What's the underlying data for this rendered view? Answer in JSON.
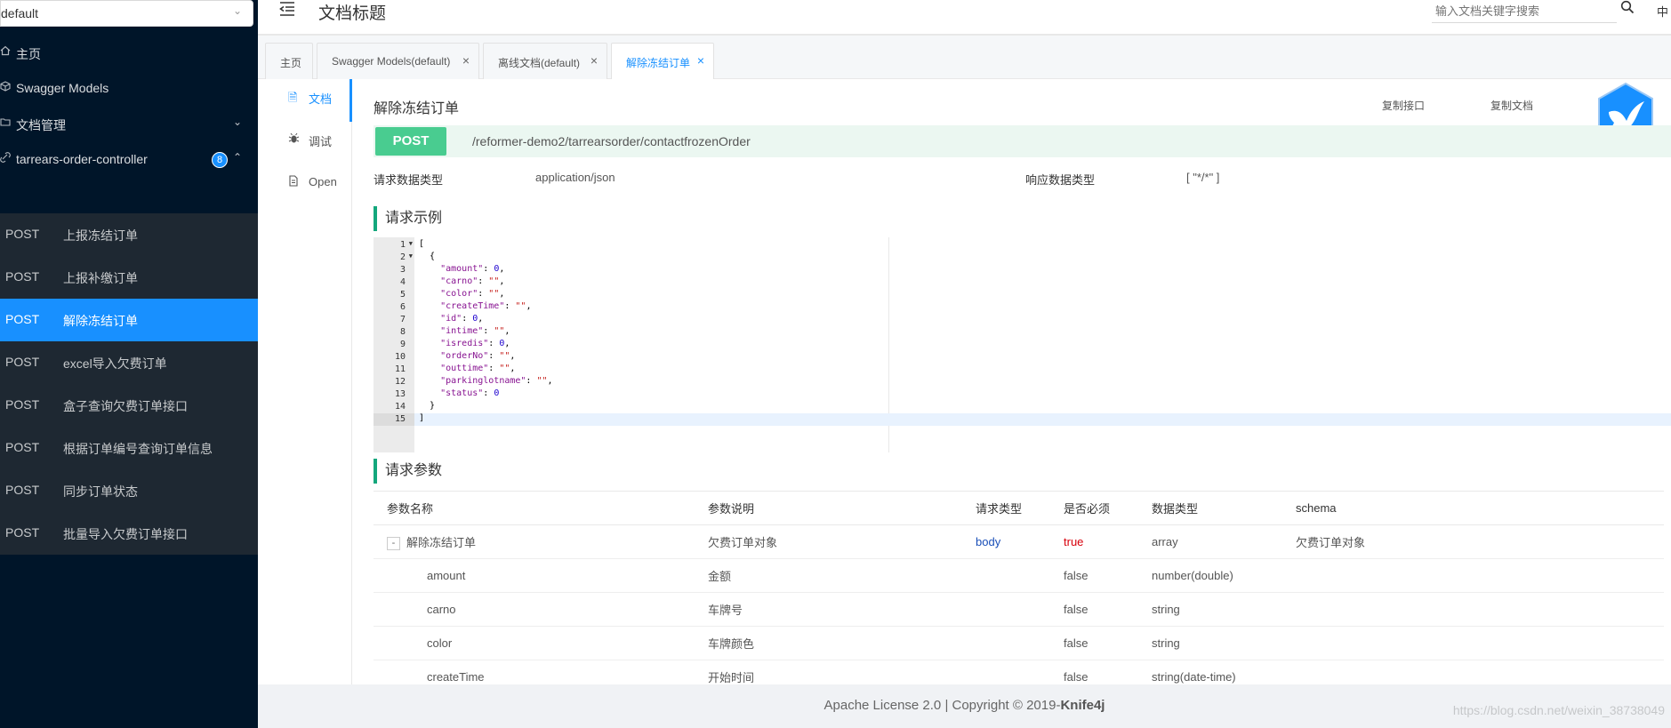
{
  "sidebar": {
    "group_select": "default",
    "items": [
      {
        "label": "主页",
        "icon": "home-icon"
      },
      {
        "label": "Swagger Models",
        "icon": "cube-icon"
      },
      {
        "label": "文档管理",
        "icon": "folder-icon"
      },
      {
        "label": "tarrears-order-controller",
        "icon": "link-icon",
        "badge": "8"
      }
    ],
    "endpoints": [
      {
        "method": "POST",
        "label": "上报冻结订单"
      },
      {
        "method": "POST",
        "label": "上报补缴订单"
      },
      {
        "method": "POST",
        "label": "解除冻结订单"
      },
      {
        "method": "POST",
        "label": "excel导入欠费订单"
      },
      {
        "method": "POST",
        "label": "盒子查询欠费订单接口"
      },
      {
        "method": "POST",
        "label": "根据订单编号查询订单信息"
      },
      {
        "method": "POST",
        "label": "同步订单状态"
      },
      {
        "method": "POST",
        "label": "批量导入欠费订单接口"
      }
    ]
  },
  "header": {
    "title": "文档标题",
    "search_placeholder": "输入文档关键字搜索",
    "lang": "中"
  },
  "tabs": [
    {
      "label": "主页",
      "closable": false
    },
    {
      "label": "Swagger Models(default)",
      "closable": true
    },
    {
      "label": "离线文档(default)",
      "closable": true
    },
    {
      "label": "解除冻结订单",
      "closable": true
    }
  ],
  "modes": [
    {
      "label": "文档",
      "icon": "doc-icon"
    },
    {
      "label": "调试",
      "icon": "bug-icon"
    },
    {
      "label": "Open",
      "icon": "file-icon"
    }
  ],
  "api": {
    "title": "解除冻结订单",
    "copy_api": "复制接口",
    "copy_doc": "复制文档",
    "method": "POST",
    "path": "/reformer-demo2/tarrearsorder/contactfrozenOrder",
    "req_type_label": "请求数据类型",
    "req_type": "application/json",
    "resp_type_label": "响应数据类型",
    "resp_type": "[ \"*/*\" ]"
  },
  "example": {
    "title": "请求示例",
    "lines": [
      "[",
      "  {",
      "    \"amount\": 0,",
      "    \"carno\": \"\",",
      "    \"color\": \"\",",
      "    \"createTime\": \"\",",
      "    \"id\": 0,",
      "    \"intime\": \"\",",
      "    \"isredis\": 0,",
      "    \"orderNo\": \"\",",
      "    \"outtime\": \"\",",
      "    \"parkinglotname\": \"\",",
      "    \"status\": 0",
      "  }",
      "]"
    ]
  },
  "params": {
    "title": "请求参数",
    "headers": [
      "参数名称",
      "参数说明",
      "请求类型",
      "是否必须",
      "数据类型",
      "schema"
    ],
    "rows": [
      {
        "name": "解除冻结订单",
        "desc": "欠费订单对象",
        "in": "body",
        "required": "true",
        "type": "array",
        "schema": "欠费订单对象",
        "expand": "-"
      },
      {
        "name": "amount",
        "desc": "金额",
        "in": "",
        "required": "false",
        "type": "number(double)",
        "schema": ""
      },
      {
        "name": "carno",
        "desc": "车牌号",
        "in": "",
        "required": "false",
        "type": "string",
        "schema": ""
      },
      {
        "name": "color",
        "desc": "车牌颜色",
        "in": "",
        "required": "false",
        "type": "string",
        "schema": ""
      },
      {
        "name": "createTime",
        "desc": "开始时间",
        "in": "",
        "required": "false",
        "type": "string(date-time)",
        "schema": ""
      }
    ]
  },
  "footer": {
    "text": "Apache License 2.0 | Copyright © 2019-",
    "brand": "Knife4j",
    "watermark": "https://blog.csdn.net/weixin_38738049"
  }
}
